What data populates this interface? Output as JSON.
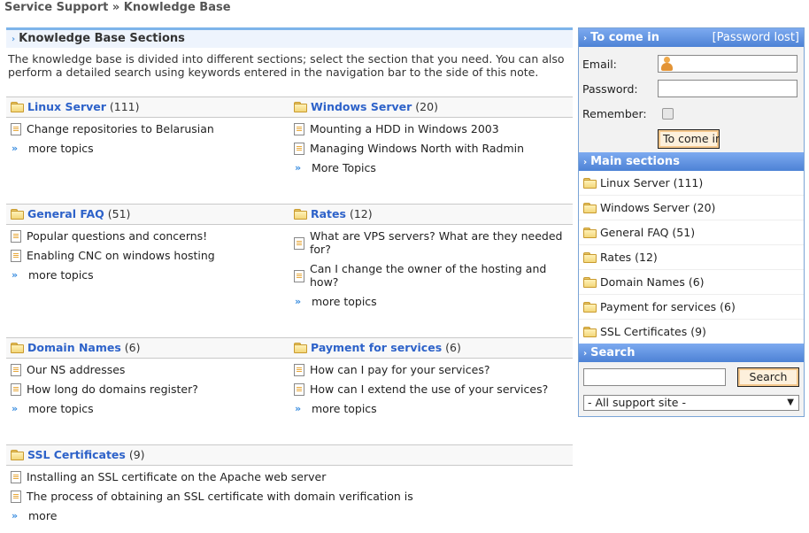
{
  "breadcrumb": "Service Support » Knowledge Base",
  "main": {
    "heading": "Knowledge Base Sections",
    "intro": "The knowledge base is divided into different sections; select the section that you need. You can also perform a detailed search using keywords entered in the navigation bar to the side of this note.",
    "sections": [
      {
        "name": "Linux Server",
        "count": "(111)",
        "topics": [
          "Change repositories to Belarusian"
        ],
        "more": "more topics"
      },
      {
        "name": "Windows Server",
        "count": "(20)",
        "topics": [
          "Mounting a HDD in Windows 2003",
          "Managing Windows North with Radmin"
        ],
        "more": "More Topics"
      },
      {
        "name": "General FAQ",
        "count": "(51)",
        "topics": [
          "Popular questions and concerns!",
          "Enabling CNC on windows hosting"
        ],
        "more": "more topics"
      },
      {
        "name": "Rates",
        "count": "(12)",
        "topics": [
          "What are VPS servers? What are they needed for?",
          "Can I change the owner of the hosting and how?"
        ],
        "more": "more topics"
      },
      {
        "name": "Domain Names",
        "count": "(6)",
        "topics": [
          "Our NS addresses",
          "How long do domains register?"
        ],
        "more": "more topics"
      },
      {
        "name": "Payment for services",
        "count": "(6)",
        "topics": [
          "How can I pay for your services?",
          "How can I extend the use of your services?"
        ],
        "more": "more topics"
      },
      {
        "name": "SSL Certificates",
        "count": "(9)",
        "topics": [
          "Installing an SSL certificate on the Apache web server",
          "The process of obtaining an SSL certificate with domain verification is"
        ],
        "more": "more"
      }
    ]
  },
  "login": {
    "title": "To come in",
    "password_lost": "[Password lost]",
    "email_label": "Email:",
    "email_value": "",
    "password_label": "Password:",
    "password_value": "",
    "remember_label": "Remember:",
    "remember_checked": false,
    "submit": "To come in"
  },
  "main_sections": {
    "title": "Main sections",
    "items": [
      "Linux Server (111)",
      "Windows Server (20)",
      "General FAQ (51)",
      "Rates (12)",
      "Domain Names (6)",
      "Payment for services (6)",
      "SSL Certificates (9)"
    ]
  },
  "search": {
    "title": "Search",
    "query": "",
    "button": "Search",
    "scope_selected": "- All support site -"
  },
  "colors": {
    "accent": "#4d82d5",
    "link": "#2d62c9",
    "header_border": "#7db4ea"
  }
}
